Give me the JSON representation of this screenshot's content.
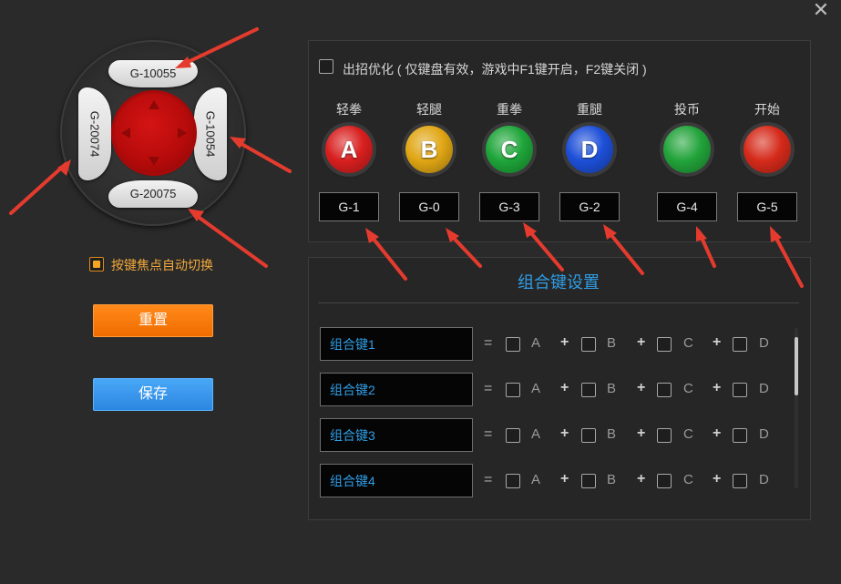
{
  "window": {
    "close_glyph": "✕"
  },
  "dpad": {
    "up": "G-10055",
    "down": "G-20075",
    "left": "G-20074",
    "right": "G-10054",
    "colors": {
      "center": "#c00c0c"
    }
  },
  "auto_switch": {
    "label": "按键焦点自动切换",
    "checked": true
  },
  "buttons": {
    "reset": "重置",
    "save": "保存"
  },
  "optimize": {
    "label": "出招优化 ( 仅键盘有效，游戏中F1键开启，F2键关闭 )",
    "checked": false
  },
  "keys": [
    {
      "label": "轻拳",
      "glyph": "A",
      "map": "G-1",
      "color": "#d91f1f"
    },
    {
      "label": "轻腿",
      "glyph": "B",
      "map": "G-0",
      "color": "#e0a614"
    },
    {
      "label": "重拳",
      "glyph": "C",
      "map": "G-3",
      "color": "#1ea539"
    },
    {
      "label": "重腿",
      "glyph": "D",
      "map": "G-2",
      "color": "#1d4fd8"
    },
    {
      "label": "投币",
      "glyph": "",
      "map": "G-4",
      "color": "#22a33a"
    },
    {
      "label": "开始",
      "glyph": "",
      "map": "G-5",
      "color": "#d52a1a"
    }
  ],
  "combo": {
    "title": "组合键设置",
    "eq": "=",
    "plus": "+",
    "letters": [
      "A",
      "B",
      "C",
      "D"
    ],
    "rows": [
      {
        "name": "组合键1"
      },
      {
        "name": "组合键2"
      },
      {
        "name": "组合键3"
      },
      {
        "name": "组合键4"
      }
    ]
  }
}
